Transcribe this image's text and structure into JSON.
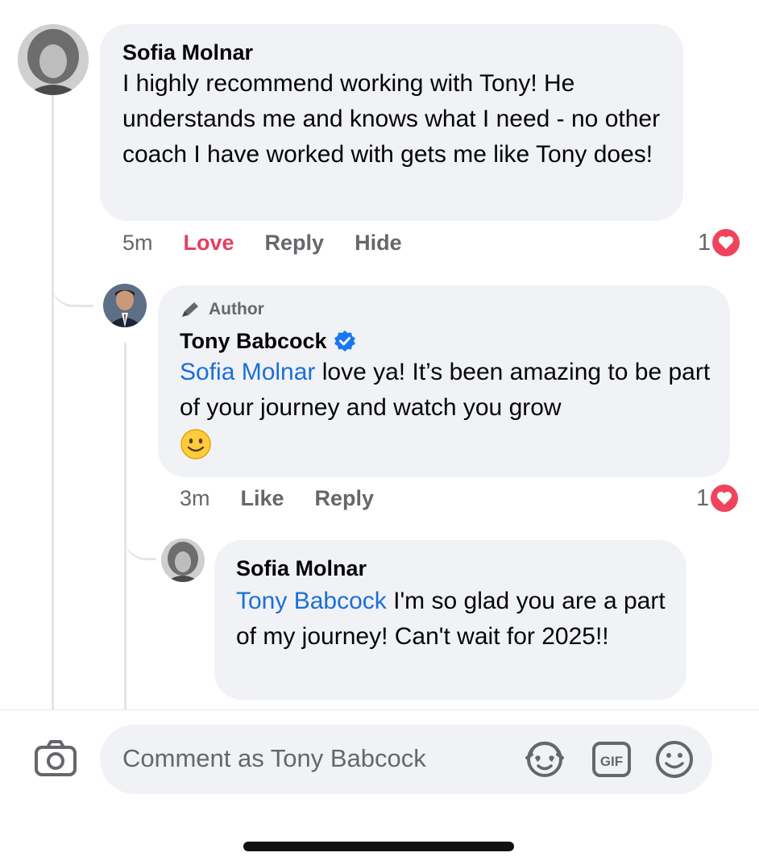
{
  "comments": [
    {
      "author": "Sofia Molnar",
      "text": "I highly recommend working with Tony! He understands me and knows what I need - no other coach I have worked with gets me like Tony does!",
      "time": "5m",
      "actions": [
        "Love",
        "Reply",
        "Hide"
      ],
      "reaction_count": "1",
      "reaction_icon": "heart-icon",
      "love_color": "#e4405f"
    },
    {
      "badge": "Author",
      "author": "Tony Babcock",
      "verified": true,
      "mention": "Sofia Molnar",
      "text": " love ya! It’s been amazing to be part of your journey and watch you grow",
      "emoji": "🙂",
      "time": "3m",
      "actions": [
        "Like",
        "Reply"
      ],
      "reaction_count": "1",
      "reaction_icon": "heart-icon"
    },
    {
      "author": "Sofia Molnar",
      "mention": "Tony Babcock",
      "text": " I'm so glad you are a part of my journey! Can't wait for 2025!!"
    }
  ],
  "composer": {
    "placeholder": "Comment as Tony Babcock",
    "icons": [
      "camera-icon",
      "avatar-sticker-icon",
      "gif-icon",
      "emoji-icon"
    ]
  },
  "colors": {
    "mention": "#1b6fd8",
    "heart": "#f0435c",
    "verified": "#1877f2",
    "bubble": "#f0f2f5"
  }
}
